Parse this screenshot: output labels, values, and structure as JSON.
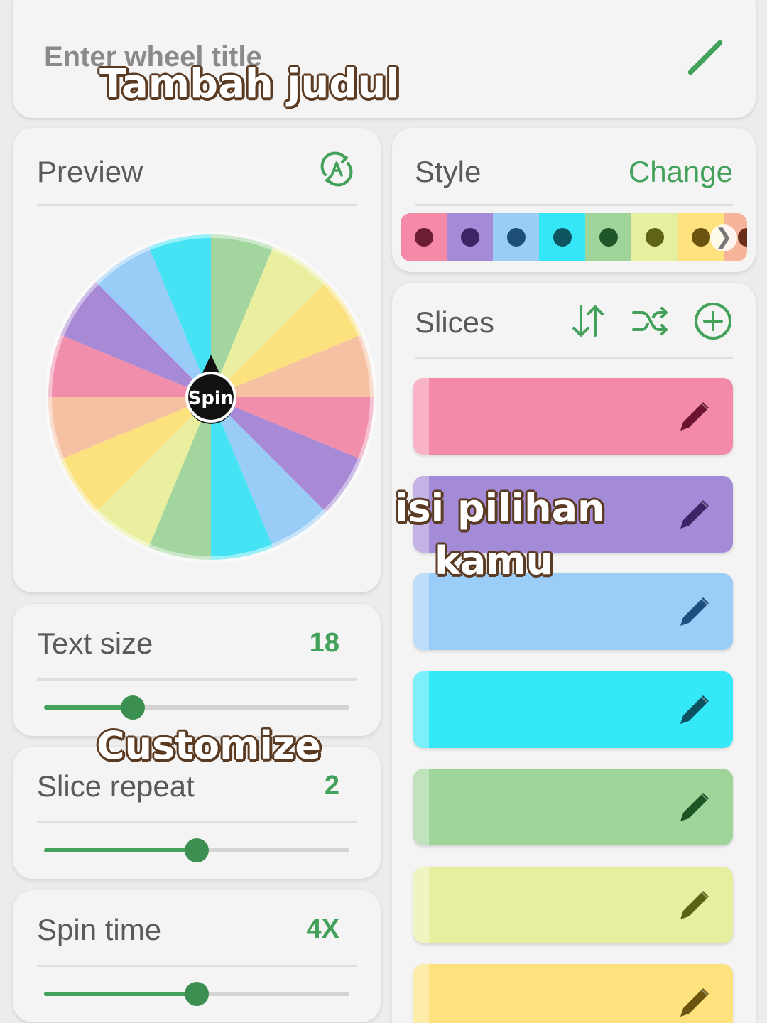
{
  "title_card": {
    "placeholder": "Enter wheel title"
  },
  "preview": {
    "label": "Preview"
  },
  "wheel": {
    "center_label": "Spin",
    "slice_colors": [
      "#a3d59f",
      "#e9ef9f",
      "#fbe27f",
      "#f6c0a3",
      "#f08eac",
      "#a789d6",
      "#99ccf6",
      "#46e3f5",
      "#a3d59f",
      "#e9ef9f",
      "#fbe27f",
      "#f6c0a3",
      "#f08eac",
      "#a789d6",
      "#99ccf6",
      "#46e3f5"
    ]
  },
  "style": {
    "label": "Style",
    "change_label": "Change",
    "swatches": [
      {
        "bg": "#f48aa8",
        "dot": "#6e1b34"
      },
      {
        "bg": "#a48bd8",
        "dot": "#3b2566"
      },
      {
        "bg": "#9acdf6",
        "dot": "#1d4e7a"
      },
      {
        "bg": "#35e6f6",
        "dot": "#0f5560"
      },
      {
        "bg": "#9fd59b",
        "dot": "#1e5627"
      },
      {
        "bg": "#e6ef9f",
        "dot": "#5e6414"
      },
      {
        "bg": "#fde27e",
        "dot": "#6b5410"
      },
      {
        "bg": "#f6b49a",
        "dot": "#6a2f1a"
      }
    ],
    "next_glyph": "❯"
  },
  "slices": {
    "label": "Slices",
    "rows": [
      {
        "color": "#f48aaa",
        "pen": "#6b1430"
      },
      {
        "color": "#a48bd8",
        "pen": "#3b2566"
      },
      {
        "color": "#9acdf8",
        "pen": "#1c4e80"
      },
      {
        "color": "#35e8f8",
        "pen": "#0e5262"
      },
      {
        "color": "#9fd59b",
        "pen": "#1d5424"
      },
      {
        "color": "#e6ef9f",
        "pen": "#5b6214"
      },
      {
        "color": "#fde27e",
        "pen": "#6a5410"
      }
    ]
  },
  "settings": {
    "text_size": {
      "label": "Text size",
      "value": "18",
      "fraction": 0.29
    },
    "slice_repeat": {
      "label": "Slice repeat",
      "value": "2",
      "fraction": 0.5
    },
    "spin_time": {
      "label": "Spin time",
      "value": "4X",
      "fraction": 0.5
    }
  },
  "overlays": {
    "title_hint": "Tambah judul",
    "slices_hint_line1": "isi pilihan",
    "slices_hint_line2": "kamu",
    "customize_hint": "Customize"
  },
  "colors": {
    "accent": "#43a15a"
  }
}
